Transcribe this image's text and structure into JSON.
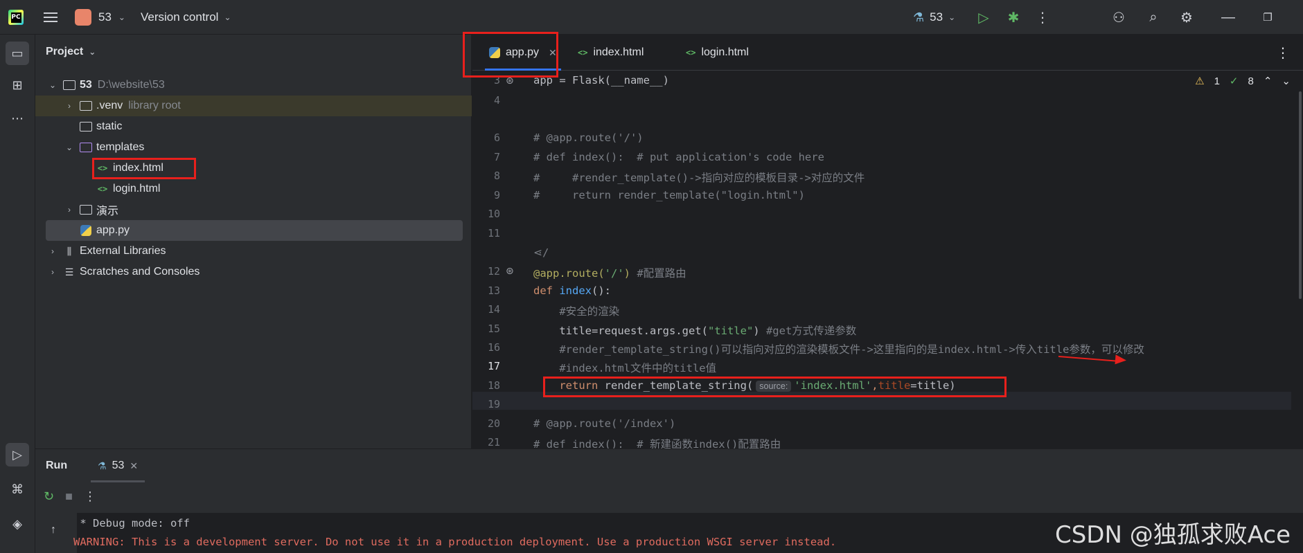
{
  "titlebar": {
    "project_name": "53",
    "vcs_label": "Version control",
    "run_config": "53"
  },
  "project_panel": {
    "title": "Project",
    "tree": {
      "root_name": "53",
      "root_path": "D:\\website\\53",
      "venv_name": ".venv",
      "venv_hint": "library root",
      "static": "static",
      "templates": "templates",
      "index_html": "index.html",
      "login_html": "login.html",
      "demo": "演示",
      "app_py": "app.py",
      "external_libraries": "External Libraries",
      "scratches": "Scratches and Consoles"
    }
  },
  "editor": {
    "tabs": [
      {
        "label": "app.py",
        "active": true
      },
      {
        "label": "index.html"
      },
      {
        "label": "login.html"
      }
    ],
    "inspections": {
      "warnings": "1",
      "ok": "8"
    },
    "lines": {
      "l3": "app = Flask(__name__)",
      "l6": "# @app.route('/')",
      "l7": "# def index():  # put application's code here",
      "l8": "#     #render_template()->指向对应的模板目录->对应的文件",
      "l9": "#     return render_template(\"login.html\")",
      "lslash": "/",
      "l12_dec": "@app.route(",
      "l12_str": "'/'",
      "l12_close": ")",
      "l12_cm": " #配置路由",
      "l13_kw": "def",
      "l13_fn": "index",
      "l13_rest": "():",
      "l14": "    #安全的渲染",
      "l15_a": "    title=request.args.get(",
      "l15_str": "\"title\"",
      "l15_b": ")",
      "l15_cm": " #get方式传递参数",
      "l16": "    #render_template_string()可以指向对应的渲染模板文件->这里指向的是index.html->传入title参数，可以修改",
      "l17": "    #index.html文件中的title值",
      "l18_kw": "return",
      "l18_call": " render_template_string(",
      "l18_hint": "source:",
      "l18_str": "'index.html'",
      "l18_comma": ",",
      "l18_param": "title",
      "l18_rest": "=title)",
      "l20": "# @app.route('/index')",
      "l21": "# def index():  # 新建函数index()配置路由"
    },
    "line_numbers": [
      "3",
      "4",
      "6",
      "7",
      "8",
      "9",
      "10",
      "11",
      "12",
      "13",
      "14",
      "15",
      "16",
      "17",
      "18",
      "19",
      "20",
      "21"
    ]
  },
  "run_panel": {
    "title": "Run",
    "tab_label": "53",
    "console": {
      "line1": " * Debug mode: off",
      "line2": "WARNING: This is a development server. Do not use it in a production deployment. Use a production WSGI server instead."
    }
  },
  "watermark": "CSDN @独孤求败Ace",
  "colors": {
    "accent": "#3574f0",
    "annotation": "#e8201c",
    "console_warning": "#e06b5f"
  }
}
